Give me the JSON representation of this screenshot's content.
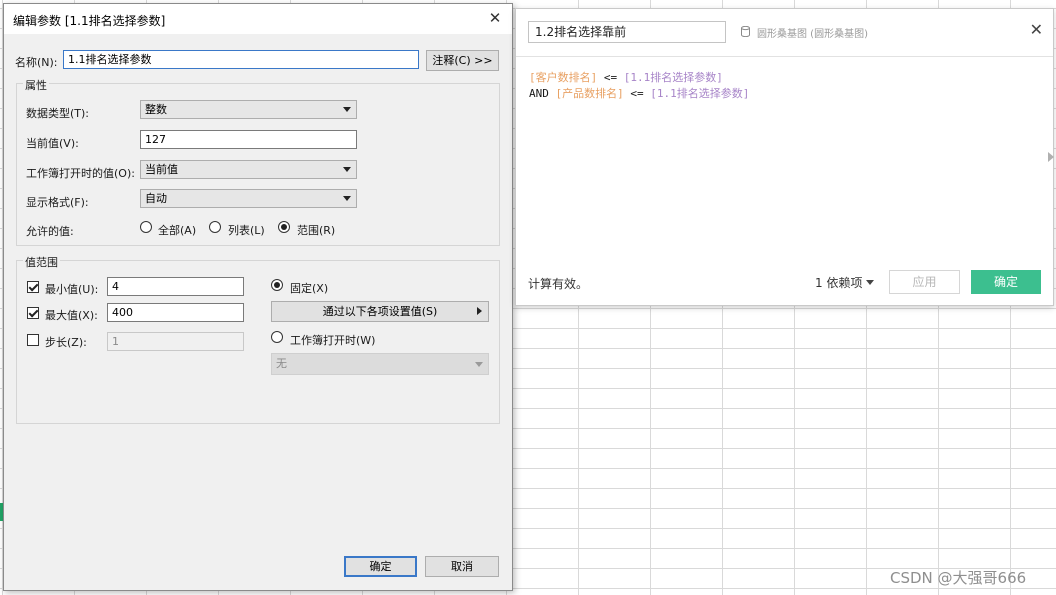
{
  "dialog": {
    "title": "编辑参数 [1.1排名选择参数]",
    "name_label": "名称",
    "name_key": "(N):",
    "name_value": "1.1排名选择参数",
    "comment_button": "注释(C) >>",
    "properties_group": "属性",
    "data_type_label": "数据类型(T):",
    "data_type_value": "整数",
    "current_value_label": "当前值(V):",
    "current_value": "127",
    "workbook_open_label": "工作簿打开时的值(O):",
    "workbook_open_value": "当前值",
    "display_format_label": "显示格式(F):",
    "display_format_value": "自动",
    "allowable_label": "允许的值:",
    "allowable_all": "全部(A)",
    "allowable_list": "列表(L)",
    "allowable_range": "范围(R)",
    "allowable_selected": "range",
    "range_group": "值范围",
    "min_label": "最小值(U):",
    "min_checked": true,
    "min_value": "4",
    "max_label": "最大值(X):",
    "max_checked": true,
    "max_value": "400",
    "step_label": "步长(Z):",
    "step_checked": false,
    "step_value": "1",
    "fixed_label": "固定(X)",
    "fixed_selected": true,
    "set_from_button": "通过以下各项设置值(S)",
    "workbook_open_radio": "工作簿打开时(W)",
    "workbook_open_radio_selected": false,
    "workbook_open_select": "无",
    "ok_button": "确定",
    "cancel_button": "取消"
  },
  "calc": {
    "name": "1.2排名选择靠前",
    "datasource": "圆形桑基图 (圆形桑基图)",
    "line1": {
      "field": "[客户数排名]",
      "op": " <= ",
      "param": "[1.1排名选择参数]"
    },
    "line2": {
      "keyword": "AND ",
      "field": "[产品数排名]",
      "op": " <= ",
      "param": "[1.1排名选择参数]"
    },
    "status": "计算有效。",
    "dependencies": "1 依赖项",
    "apply_button": "应用",
    "ok_button": "确定"
  },
  "watermark": "CSDN @大强哥666",
  "colors": {
    "accent_green": "#3cbf8f",
    "field_orange": "#e8a062",
    "param_purple": "#a784c8",
    "focus_blue": "#3a78c8"
  },
  "icons": {
    "dialog_close": "close-icon",
    "datasource": "database-icon",
    "calc_close": "close-icon"
  }
}
